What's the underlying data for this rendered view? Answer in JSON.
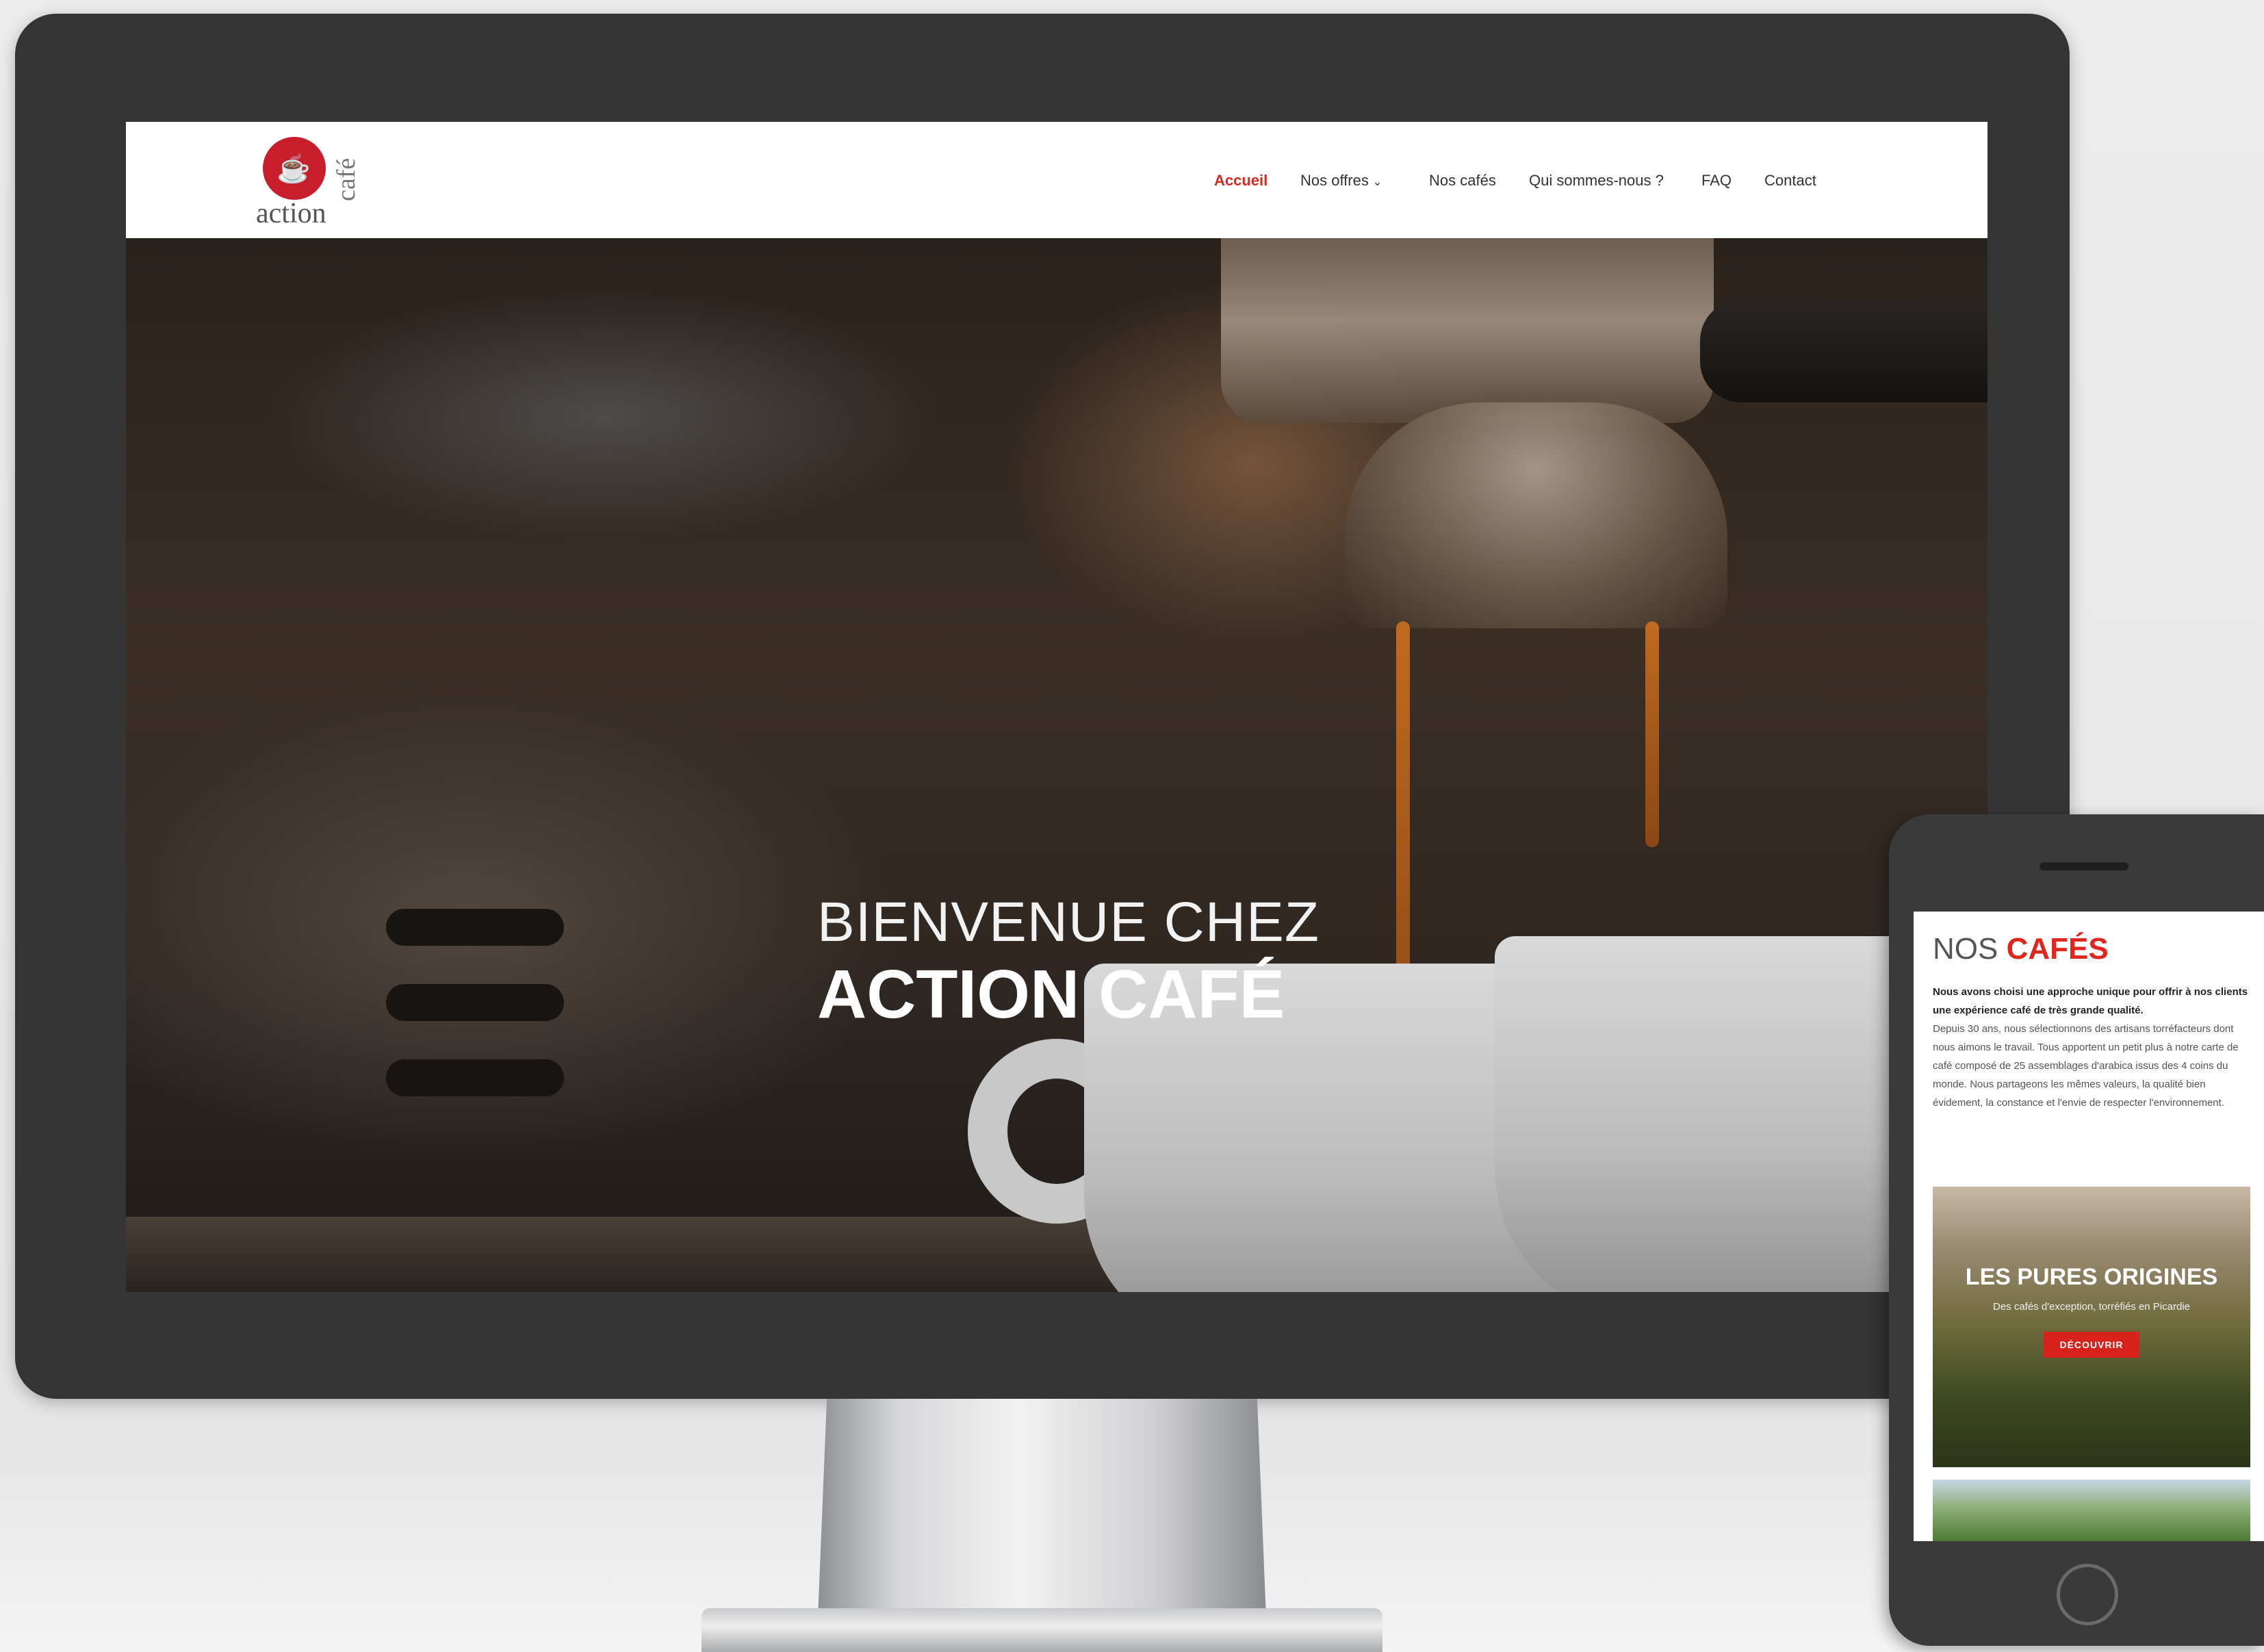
{
  "brand": {
    "logo_top": "café",
    "logo_bottom": "action"
  },
  "nav": {
    "items": [
      {
        "label": "Accueil",
        "active": true
      },
      {
        "label": "Nos offres",
        "has_dropdown": true
      },
      {
        "label": "Nos cafés"
      },
      {
        "label": "Qui sommes-nous ?"
      },
      {
        "label": "FAQ"
      },
      {
        "label": "Contact"
      }
    ]
  },
  "hero": {
    "line1": "BIENVENUE CHEZ",
    "line2": "ACTION CAFÉ"
  },
  "mobile": {
    "title_part1": "NOS ",
    "title_part2": "CAFÉS",
    "lead": "Nous avons choisi une approche unique pour offrir à nos clients une expérience café de très grande qualité.",
    "body": "Depuis 30 ans, nous sélectionnons des artisans torréfacteurs dont nous aimons le travail. Tous apportent un petit plus à notre carte de café composé de 25 assemblages d'arabica issus des 4 coins du monde. Nous partageons les mêmes valeurs, la qualité bien évidement, la constance et l'envie de respecter l'environnement.",
    "card": {
      "title": "LES PURES ORIGINES",
      "subtitle": "Des cafés d'exception, torréfiés en Picardie",
      "button": "DÉCOUVRIR"
    }
  },
  "colors": {
    "accent": "#d52a1e",
    "logo_red": "#c81e2b",
    "bezel": "#343434"
  },
  "icons": {
    "dropdown": "chevron-down-icon",
    "logo_cup": "coffee-cup-icon"
  }
}
